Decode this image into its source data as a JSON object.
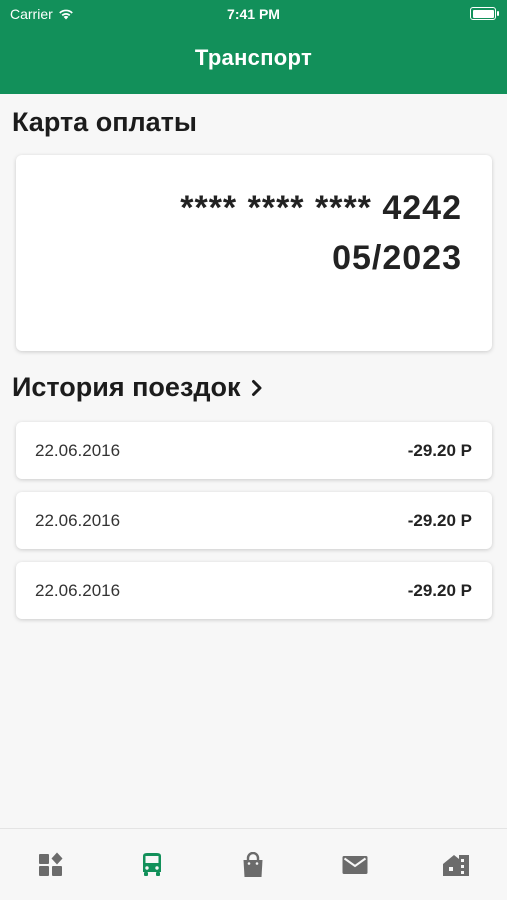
{
  "status_bar": {
    "carrier": "Carrier",
    "time": "7:41 PM",
    "battery_level": 1.0
  },
  "header": {
    "title": "Транспорт"
  },
  "payment_card": {
    "section_title": "Карта оплаты",
    "masked_number": "**** **** **** 4242",
    "expiry": "05/2023"
  },
  "trip_history": {
    "section_title": "История поездок",
    "trips": [
      {
        "date": "22.06.2016",
        "amount": "-29.20 Р"
      },
      {
        "date": "22.06.2016",
        "amount": "-29.20 Р"
      },
      {
        "date": "22.06.2016",
        "amount": "-29.20 Р"
      }
    ]
  },
  "tab_bar": {
    "active_tab": "transport",
    "active_color": "#12905a",
    "inactive_color": "#6b6b6b",
    "tabs": [
      {
        "id": "dashboard",
        "icon": "dashboard-icon"
      },
      {
        "id": "transport",
        "icon": "bus-icon"
      },
      {
        "id": "shop",
        "icon": "shopping-bag-icon"
      },
      {
        "id": "mail",
        "icon": "mail-icon"
      },
      {
        "id": "home",
        "icon": "house-icon"
      }
    ]
  },
  "colors": {
    "brand": "#12905a",
    "background": "#f7f7f7",
    "card": "#ffffff"
  }
}
